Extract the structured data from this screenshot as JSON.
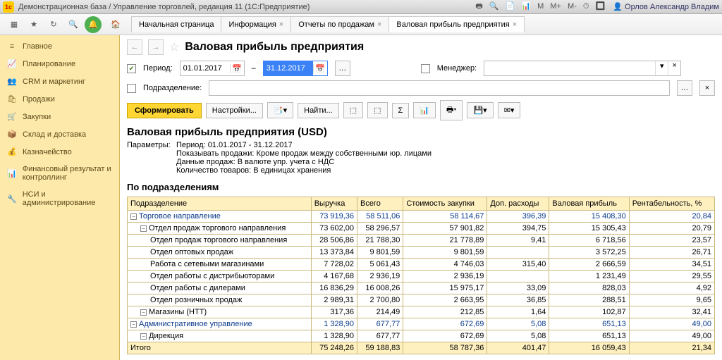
{
  "titleBar": {
    "appTitle": "Демонстрационная база / Управление торговлей, редакция 11   (1С:Предприятие)",
    "user": "Орлов Александр Владим"
  },
  "topTabs": {
    "start": "Начальная страница",
    "t1": "Информация",
    "t2": "Отчеты по продажам",
    "t3": "Валовая прибыль предприятия"
  },
  "sidebar": [
    {
      "icon": "≡",
      "label": "Главное"
    },
    {
      "icon": "📈",
      "label": "Планирование"
    },
    {
      "icon": "👥",
      "label": "CRM и маркетинг"
    },
    {
      "icon": "🛍",
      "label": "Продажи"
    },
    {
      "icon": "🛒",
      "label": "Закупки"
    },
    {
      "icon": "📦",
      "label": "Склад и доставка"
    },
    {
      "icon": "💰",
      "label": "Казначейство"
    },
    {
      "icon": "📊",
      "label": "Финансовый результат и контроллинг"
    },
    {
      "icon": "🔧",
      "label": "НСИ и администрирование"
    }
  ],
  "page": {
    "title": "Валовая прибыль предприятия",
    "periodLabel": "Период:",
    "dateFrom": "01.01.2017",
    "dateTo": "31.12.2017",
    "managerLabel": "Менеджер:",
    "deptLabel": "Подразделение:",
    "btnForm": "Сформировать",
    "btnSettings": "Настройки...",
    "btnFind": "Найти..."
  },
  "report": {
    "title": "Валовая прибыль предприятия (USD)",
    "paramsLabel": "Параметры:",
    "paramLines": [
      "Период: 01.01.2017 - 31.12.2017",
      "Показывать продажи: Кроме продаж между собственными юр. лицами",
      "Данные продаж: В валюте упр. учета с НДС",
      "Количество товаров: В единицах хранения"
    ],
    "sectionTitle": "По подразделениям",
    "columns": [
      "Подразделение",
      "Выручка",
      "Всего",
      "Стоимость закупки",
      "Доп. расходы",
      "Валовая прибыль",
      "Рентабельность, %"
    ],
    "rows": [
      {
        "level": 0,
        "group": true,
        "name": "Торговое направление",
        "v": [
          "73 919,36",
          "58 511,06",
          "58 114,67",
          "396,39",
          "15 408,30",
          "20,84"
        ]
      },
      {
        "level": 1,
        "name": "Отдел продаж торгового направления",
        "v": [
          "73 602,00",
          "58 296,57",
          "57 901,82",
          "394,75",
          "15 305,43",
          "20,79"
        ]
      },
      {
        "level": 2,
        "name": "Отдел продаж торгового направления",
        "v": [
          "28 506,86",
          "21 788,30",
          "21 778,89",
          "9,41",
          "6 718,56",
          "23,57"
        ]
      },
      {
        "level": 2,
        "name": "Отдел оптовых продаж",
        "v": [
          "13 373,84",
          "9 801,59",
          "9 801,59",
          "",
          "3 572,25",
          "26,71"
        ]
      },
      {
        "level": 2,
        "name": "Работа с сетевыми магазинами",
        "v": [
          "7 728,02",
          "5 061,43",
          "4 746,03",
          "315,40",
          "2 666,59",
          "34,51"
        ]
      },
      {
        "level": 2,
        "name": "Отдел работы с дистрибьюторами",
        "v": [
          "4 167,68",
          "2 936,19",
          "2 936,19",
          "",
          "1 231,49",
          "29,55"
        ]
      },
      {
        "level": 2,
        "name": "Отдел работы с дилерами",
        "v": [
          "16 836,29",
          "16 008,26",
          "15 975,17",
          "33,09",
          "828,03",
          "4,92"
        ]
      },
      {
        "level": 2,
        "name": "Отдел розничных продаж",
        "v": [
          "2 989,31",
          "2 700,80",
          "2 663,95",
          "36,85",
          "288,51",
          "9,65"
        ]
      },
      {
        "level": 1,
        "name": "Магазины (НТТ)",
        "v": [
          "317,36",
          "214,49",
          "212,85",
          "1,64",
          "102,87",
          "32,41"
        ]
      },
      {
        "level": 0,
        "group": true,
        "name": "Административное управление",
        "v": [
          "1 328,90",
          "677,77",
          "672,69",
          "5,08",
          "651,13",
          "49,00"
        ]
      },
      {
        "level": 1,
        "name": "Дирекция",
        "v": [
          "1 328,90",
          "677,77",
          "672,69",
          "5,08",
          "651,13",
          "49,00"
        ]
      }
    ],
    "total": {
      "name": "Итого",
      "v": [
        "75 248,26",
        "59 188,83",
        "58 787,36",
        "401,47",
        "16 059,43",
        "21,34"
      ]
    }
  }
}
